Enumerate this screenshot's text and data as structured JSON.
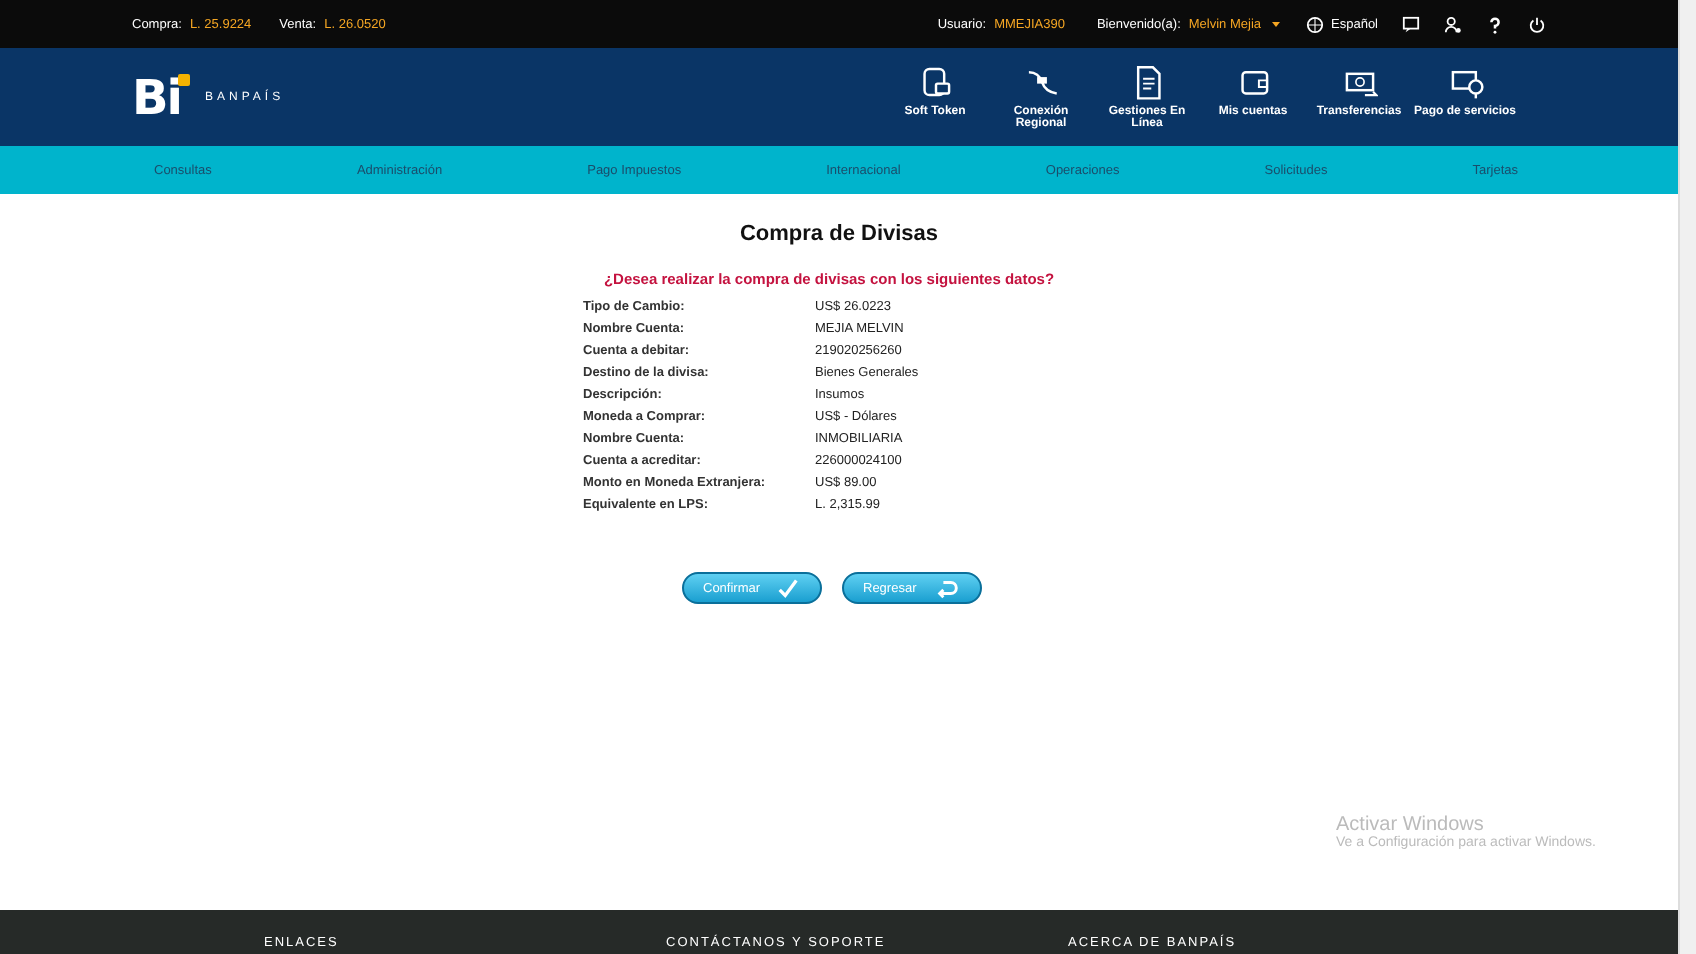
{
  "top_bar": {
    "buy_label": "Compra:",
    "buy_value": "L. 25.9224",
    "sell_label": "Venta:",
    "sell_value": "L. 26.0520",
    "user_label": "Usuario:",
    "user_value": "MMEJIA390",
    "welcome_label": "Bienvenido(a):",
    "welcome_value": "Melvin Mejia",
    "language": "Español"
  },
  "header": {
    "logo": "Bi",
    "brand": "BANPAÍS",
    "shortcuts": [
      {
        "label": "Soft Token"
      },
      {
        "label": "Conexión Regional"
      },
      {
        "label": "Gestiones En Línea"
      },
      {
        "label": "Mis cuentas"
      },
      {
        "label": "Transferencias"
      },
      {
        "label": "Pago de servicios"
      }
    ]
  },
  "nav": [
    "Consultas",
    "Administración",
    "Pago Impuestos",
    "Internacional",
    "Operaciones",
    "Solicitudes",
    "Tarjetas"
  ],
  "page": {
    "title": "Compra de Divisas",
    "question": "¿Desea realizar la compra de divisas con los siguientes datos?",
    "rows": [
      {
        "label": "Tipo de Cambio:",
        "value": "US$  26.0223"
      },
      {
        "label": "Nombre Cuenta:",
        "value": "MEJIA MELVIN"
      },
      {
        "label": "Cuenta a debitar:",
        "value": "219020256260"
      },
      {
        "label": "Destino de la divisa:",
        "value": "Bienes Generales"
      },
      {
        "label": "Descripción:",
        "value": "Insumos"
      },
      {
        "label": "Moneda a Comprar:",
        "value": "US$ - Dólares"
      },
      {
        "label": "Nombre Cuenta:",
        "value": "INMOBILIARIA"
      },
      {
        "label": "Cuenta a acreditar:",
        "value": "226000024100"
      },
      {
        "label": "Monto en Moneda Extranjera:",
        "value": "US$  89.00"
      },
      {
        "label": "Equivalente en LPS:",
        "value": "L. 2,315.99"
      }
    ],
    "buttons": [
      {
        "label": "Confirmar"
      },
      {
        "label": "Regresar"
      }
    ]
  },
  "os_notice": {
    "title": "Activar Windows",
    "text": "Ve a Configuración para activar Windows."
  },
  "footer": [
    "ENLACES",
    "CONTÁCTANOS Y SOPORTE",
    "ACERCA DE BANPAÍS"
  ]
}
